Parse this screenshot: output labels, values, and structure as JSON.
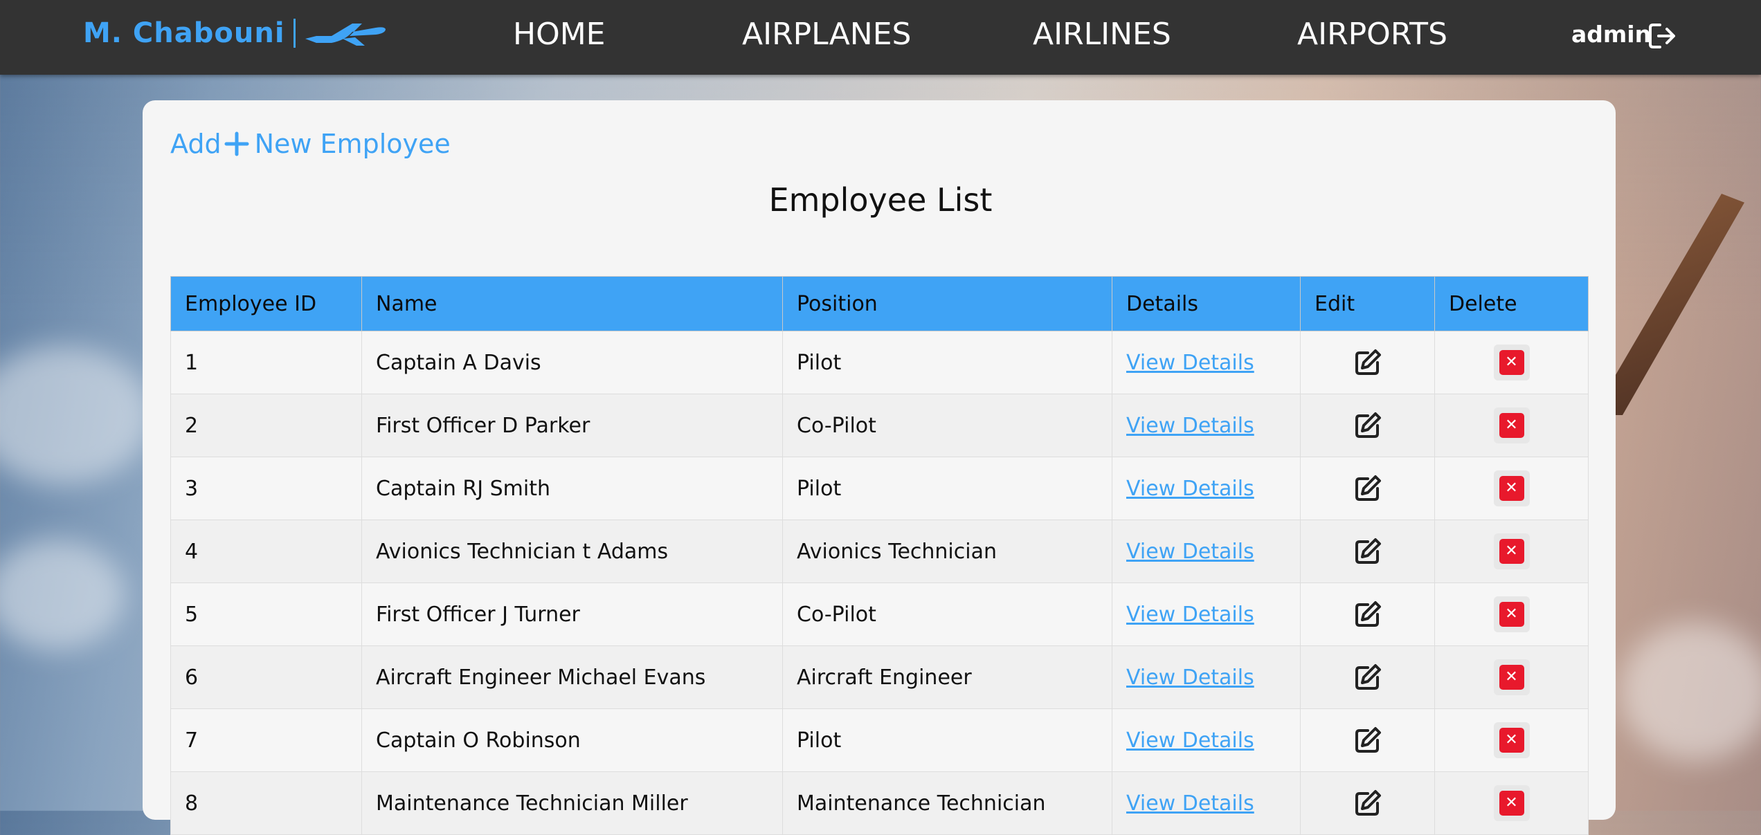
{
  "brand": {
    "name": "M. Chabouni",
    "accent": "#3fa3f5"
  },
  "nav": {
    "links": [
      "HOME",
      "AIRPLANES",
      "AIRLINES",
      "AIRPORTS"
    ],
    "user": "admin",
    "logout_icon": "logout-icon"
  },
  "main": {
    "add_label": "Add",
    "add_label_rest": "New Employee",
    "title": "Employee List"
  },
  "table": {
    "headers": [
      "Employee ID",
      "Name",
      "Position",
      "Details",
      "Edit",
      "Delete"
    ],
    "details_label": "View Details",
    "rows": [
      {
        "id": "1",
        "name": "Captain A Davis",
        "position": "Pilot"
      },
      {
        "id": "2",
        "name": "First Officer D Parker",
        "position": "Co-Pilot"
      },
      {
        "id": "3",
        "name": "Captain RJ Smith",
        "position": "Pilot"
      },
      {
        "id": "4",
        "name": "Avionics Technician t Adams",
        "position": "Avionics Technician"
      },
      {
        "id": "5",
        "name": "First Officer J Turner",
        "position": "Co-Pilot"
      },
      {
        "id": "6",
        "name": "Aircraft Engineer Michael Evans",
        "position": "Aircraft Engineer"
      },
      {
        "id": "7",
        "name": "Captain O Robinson",
        "position": "Pilot"
      },
      {
        "id": "8",
        "name": "Maintenance Technician Miller",
        "position": "Maintenance Technician"
      }
    ]
  },
  "colors": {
    "navbar": "#333333",
    "header": "#3fa3f5",
    "delete": "#e8192c"
  }
}
